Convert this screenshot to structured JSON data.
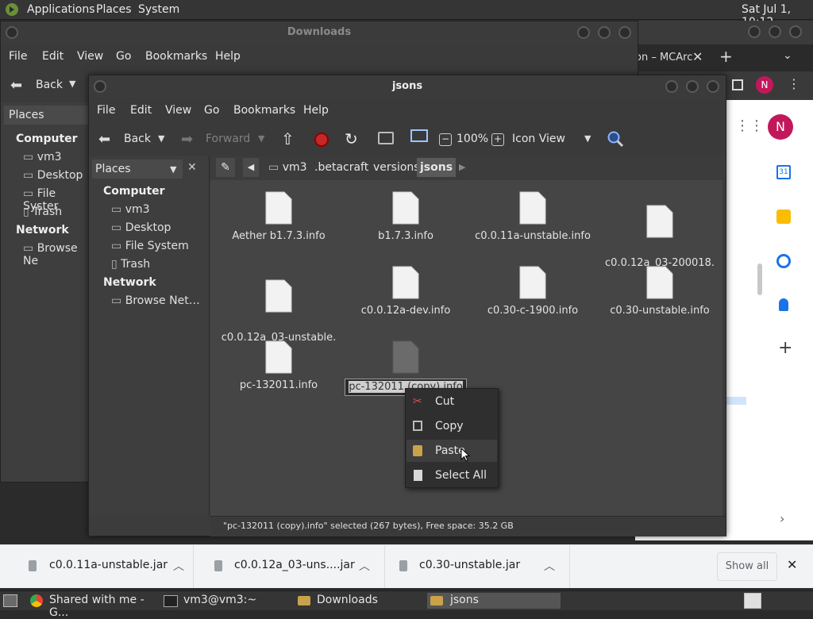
{
  "top_panel": {
    "menus": [
      "Applications",
      "Places",
      "System"
    ],
    "clock": "Sat Jul  1, 10:12"
  },
  "chrome": {
    "tab_title": "on – MCArc",
    "profile_initial": "N",
    "avatar_color": "#c2185b"
  },
  "downloads_window": {
    "title": "Downloads",
    "menus": [
      "File",
      "Edit",
      "View",
      "Go",
      "Bookmarks",
      "Help"
    ],
    "back_label": "Back",
    "places_label": "Places",
    "computer_head": "Computer",
    "items": [
      "vm3",
      "Desktop",
      "File Syster",
      "Trash"
    ],
    "network_head": "Network",
    "network_items": [
      "Browse Ne"
    ]
  },
  "jsons_window": {
    "title": "jsons",
    "menus": [
      "File",
      "Edit",
      "View",
      "Go",
      "Bookmarks",
      "Help"
    ],
    "toolbar": {
      "back": "Back",
      "forward": "Forward",
      "zoom": "100%",
      "view_mode": "Icon View"
    },
    "sidebar": {
      "selector": "Places",
      "computer_head": "Computer",
      "items": [
        "vm3",
        "Desktop",
        "File System",
        "Trash"
      ],
      "network_head": "Network",
      "network_items": [
        "Browse Net…"
      ]
    },
    "breadcrumbs": [
      "vm3",
      ".betacraft",
      "versions",
      "jsons"
    ],
    "files": [
      {
        "name": "Aether b1.7.3.info"
      },
      {
        "name": "b1.7.3.info"
      },
      {
        "name": "c0.0.11a-unstable.info"
      },
      {
        "name": "c0.0.12a_03-200018.\ninfo"
      },
      {
        "name": "c0.0.12a_03-unstable.\ninfo"
      },
      {
        "name": "c0.0.12a-dev.info"
      },
      {
        "name": "c0.30-c-1900.info"
      },
      {
        "name": "c0.30-unstable.info"
      },
      {
        "name": "pc-132011.info"
      }
    ],
    "rename_value": "pc-132011 (copy).info",
    "status": "\"pc-132011 (copy).info\" selected (267 bytes), Free space: 35.2 GB"
  },
  "context_menu": {
    "items": [
      "Cut",
      "Copy",
      "Paste",
      "Select All"
    ]
  },
  "download_shelf": {
    "items": [
      "c0.0.11a-unstable.jar",
      "c0.0.12a_03-uns....jar",
      "c0.30-unstable.jar"
    ],
    "show_all": "Show all"
  },
  "taskbar": {
    "tasks": [
      "Shared with me - G...",
      "vm3@vm3:~",
      "Downloads",
      "jsons"
    ]
  }
}
